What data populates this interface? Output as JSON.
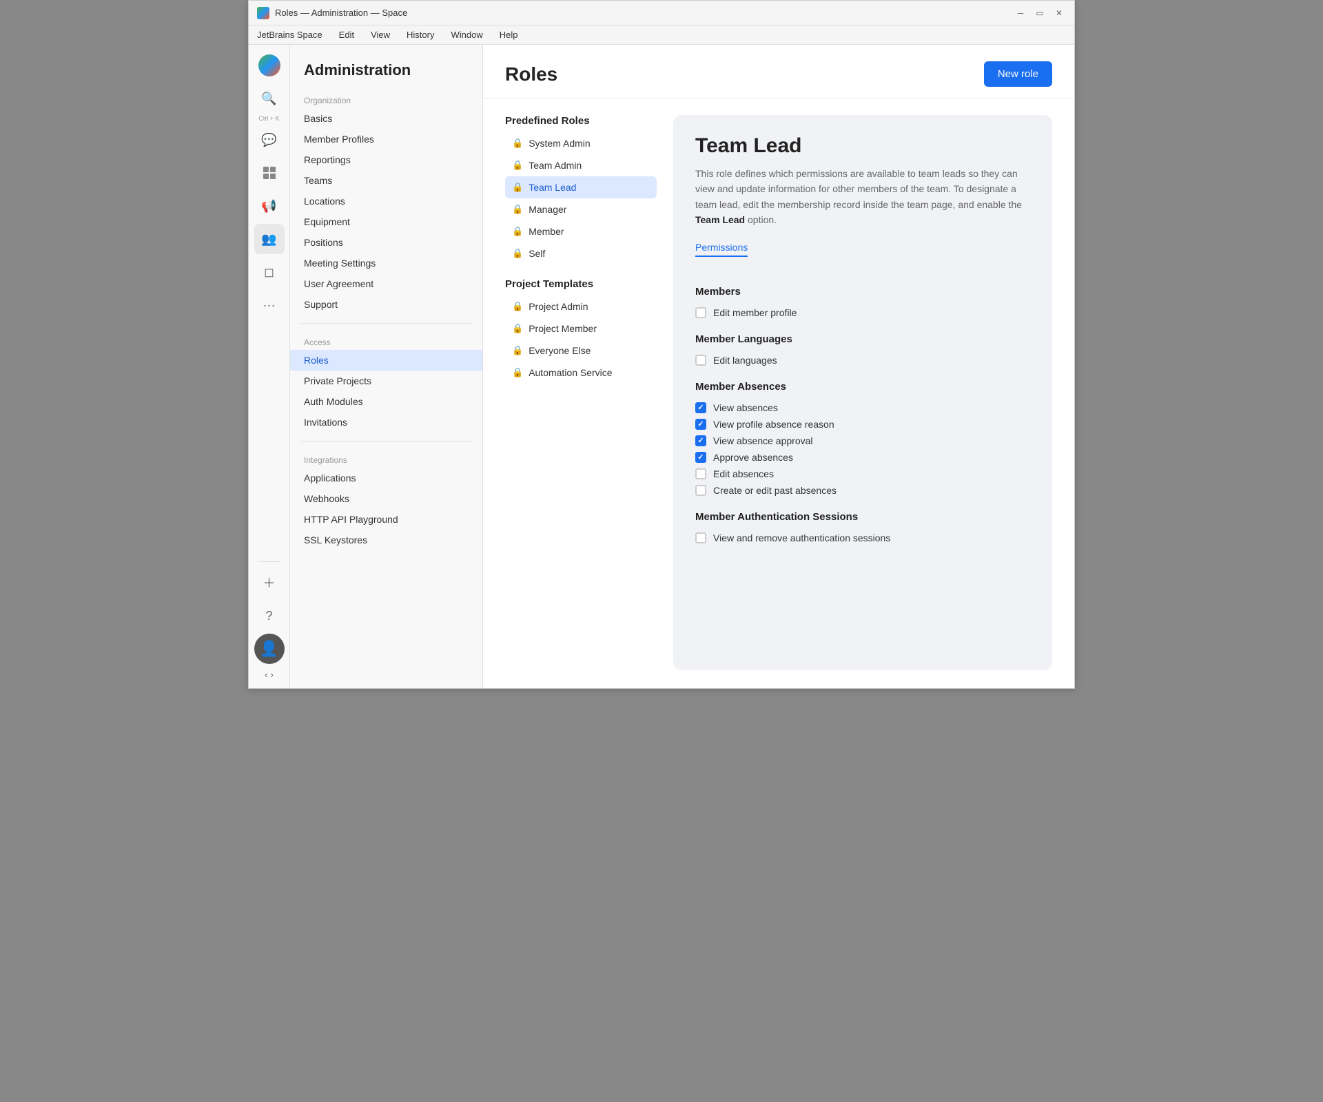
{
  "window": {
    "title": "Roles — Administration — Space",
    "menu_items": [
      "JetBrains Space",
      "Edit",
      "View",
      "History",
      "Window",
      "Help"
    ]
  },
  "rail": {
    "search_label": "Ctrl + K",
    "icons": [
      "●",
      "🔍",
      "💬",
      "⊞",
      "📢",
      "👥",
      "◻",
      "···"
    ]
  },
  "sidebar": {
    "title": "Administration",
    "sections": [
      {
        "label": "Organization",
        "items": [
          "Basics",
          "Member Profiles",
          "Reportings",
          "Teams",
          "Locations",
          "Equipment",
          "Positions",
          "Meeting Settings",
          "User Agreement",
          "Support"
        ]
      },
      {
        "label": "Access",
        "items": [
          "Roles",
          "Private Projects",
          "Auth Modules",
          "Invitations"
        ]
      },
      {
        "label": "Integrations",
        "items": [
          "Applications",
          "Webhooks",
          "HTTP API Playground",
          "SSL Keystores"
        ]
      }
    ],
    "active_item": "Roles"
  },
  "main": {
    "title": "Roles",
    "new_role_label": "New role"
  },
  "predefined_roles": {
    "section_title": "Predefined Roles",
    "items": [
      "System Admin",
      "Team Admin",
      "Team Lead",
      "Manager",
      "Member",
      "Self"
    ]
  },
  "project_templates": {
    "section_title": "Project Templates",
    "items": [
      "Project Admin",
      "Project Member",
      "Everyone Else",
      "Automation Service"
    ]
  },
  "active_role": {
    "name": "Team Lead",
    "description": "This role defines which permissions are available to team leads so they can view and update information for other members of the team. To designate a team lead, edit the membership record inside the team page, and enable the ",
    "description_bold": "Team Lead",
    "description_end": " option.",
    "permissions_tab": "Permissions",
    "sections": [
      {
        "title": "Members",
        "items": [
          {
            "label": "Edit member profile",
            "checked": false
          }
        ]
      },
      {
        "title": "Member Languages",
        "items": [
          {
            "label": "Edit languages",
            "checked": false
          }
        ]
      },
      {
        "title": "Member Absences",
        "items": [
          {
            "label": "View absences",
            "checked": true
          },
          {
            "label": "View profile absence reason",
            "checked": true
          },
          {
            "label": "View absence approval",
            "checked": true
          },
          {
            "label": "Approve absences",
            "checked": true
          },
          {
            "label": "Edit absences",
            "checked": false
          },
          {
            "label": "Create or edit past absences",
            "checked": false
          }
        ]
      },
      {
        "title": "Member Authentication Sessions",
        "items": [
          {
            "label": "View and remove authentication sessions",
            "checked": false
          }
        ]
      }
    ]
  }
}
